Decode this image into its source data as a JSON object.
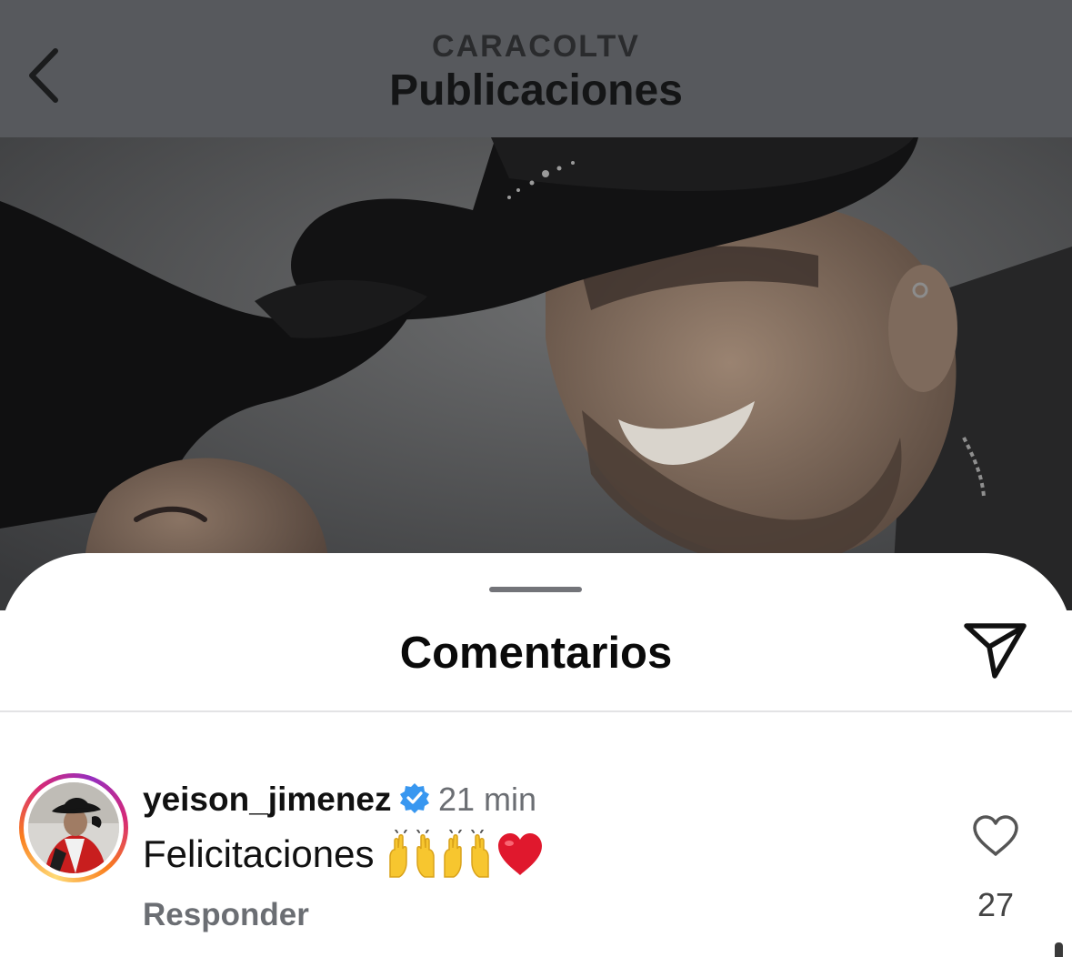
{
  "header": {
    "account": "CARACOLTV",
    "title": "Publicaciones",
    "back_icon": "chevron-left-icon"
  },
  "post": {
    "media": "photo"
  },
  "comments_sheet": {
    "title": "Comentarios",
    "share_icon": "paper-plane-icon"
  },
  "comments": [
    {
      "username": "yeison_jimenez",
      "verified": true,
      "time": "21 min",
      "text": "Felicitaciones",
      "emojis": [
        "raising-hands",
        "raising-hands",
        "red-heart"
      ],
      "reply_label": "Responder",
      "likes": "27"
    }
  ],
  "colors": {
    "verified_blue": "#3897f0",
    "heart_red": "#e0182d",
    "secondary_text": "#6b6e73"
  }
}
